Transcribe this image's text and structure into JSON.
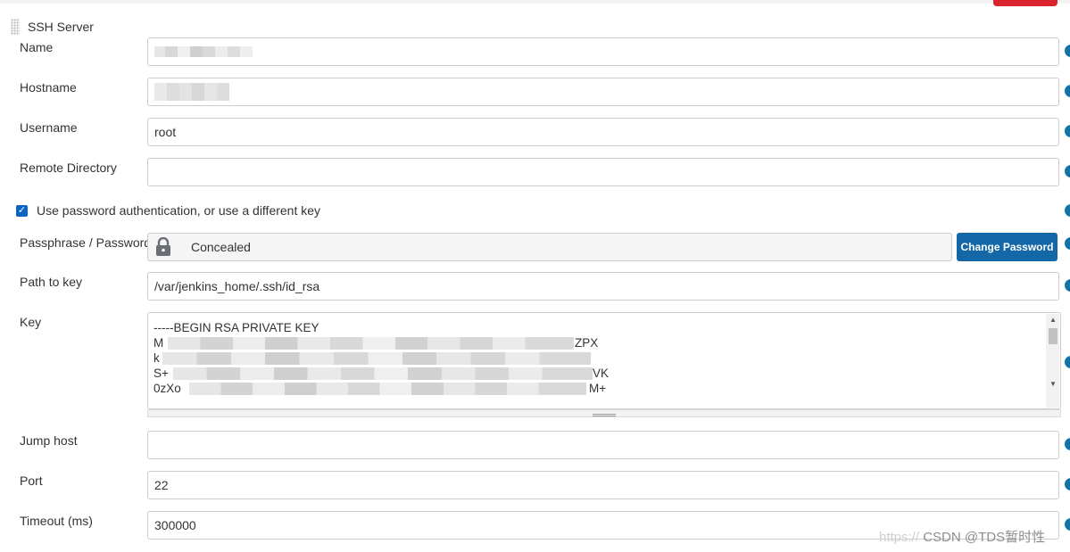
{
  "section": {
    "title": "SSH Server"
  },
  "fields": {
    "name": {
      "label": "Name",
      "value": ""
    },
    "hostname": {
      "label": "Hostname",
      "value": ""
    },
    "username": {
      "label": "Username",
      "value": "root"
    },
    "remote_directory": {
      "label": "Remote Directory",
      "value": ""
    },
    "use_password": {
      "label": "Use password authentication, or use a different key",
      "checked": true
    },
    "passphrase": {
      "label": "Passphrase / Password",
      "value": "Concealed",
      "button": "Change Password"
    },
    "path_to_key": {
      "label": "Path to key",
      "value": "/var/jenkins_home/.ssh/id_rsa"
    },
    "key": {
      "label": "Key",
      "lines": [
        "-----BEGIN RSA PRIVATE KEY",
        "M",
        "k",
        "S+",
        "0zXo"
      ],
      "line_suffixes": [
        "",
        "ZPX",
        "",
        "VK",
        "M+"
      ]
    },
    "jump_host": {
      "label": "Jump host",
      "value": ""
    },
    "port": {
      "label": "Port",
      "value": "22"
    },
    "timeout": {
      "label": "Timeout (ms)",
      "value": "300000"
    }
  },
  "watermark": {
    "text_faint": "https://",
    "text": "CSDN @TDS暂时性"
  },
  "colors": {
    "accent": "#1468a8",
    "help_dot": "#1273a8",
    "checkbox": "#0b64c4",
    "top_accent": "#d9232e"
  },
  "icons": {
    "lock": "lock-icon",
    "help": "help-icon",
    "drag": "drag-handle-icon"
  }
}
